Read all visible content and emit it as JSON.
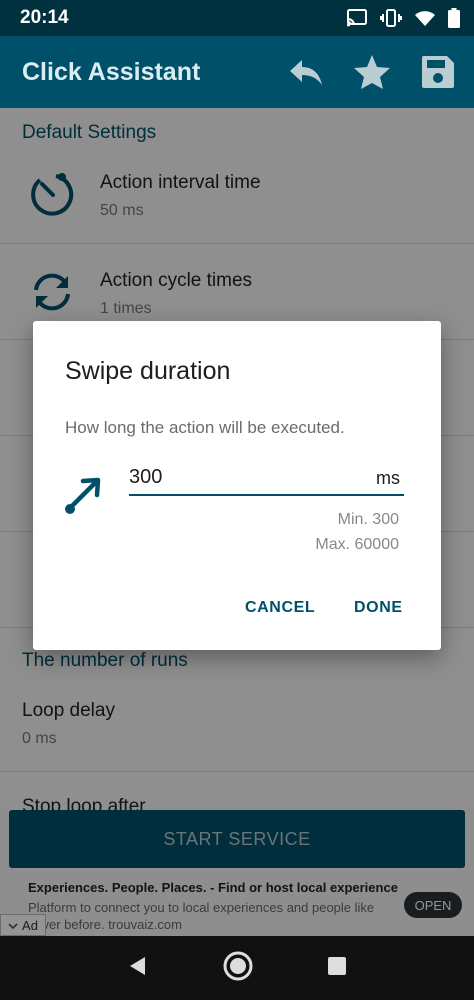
{
  "status_bar": {
    "time": "20:14"
  },
  "app_bar": {
    "title": "Click Assistant",
    "actions": [
      "undo-icon",
      "star-icon",
      "save-icon"
    ]
  },
  "settings": {
    "section_default": "Default Settings",
    "items": [
      {
        "title": "Action interval time",
        "subtitle": "50 ms",
        "icon": "timer-icon"
      },
      {
        "title": "Action cycle times",
        "subtitle": "1 times",
        "icon": "sync-icon"
      }
    ],
    "section_runs": "The number of runs",
    "loop_delay": {
      "title": "Loop delay",
      "subtitle": "0 ms"
    },
    "stop_loop": {
      "title": "Stop loop after"
    }
  },
  "dialog": {
    "title": "Swipe duration",
    "message": "How long the action will be executed.",
    "input_value": "300",
    "unit": "ms",
    "min": "Min. 300",
    "max": "Max. 60000",
    "cancel": "CANCEL",
    "done": "DONE",
    "icon": "swipe-arrow-icon"
  },
  "start_button": "START SERVICE",
  "ad": {
    "title": "Experiences. People. Places. - Find or host local experiences",
    "body": "Platform to connect you to local experiences and people like never before. trouvaiz.com",
    "cta": "OPEN",
    "badge": "Ad"
  },
  "colors": {
    "primary": "#01506a",
    "status_bar": "#01303f",
    "accent_text": "#01506a"
  }
}
